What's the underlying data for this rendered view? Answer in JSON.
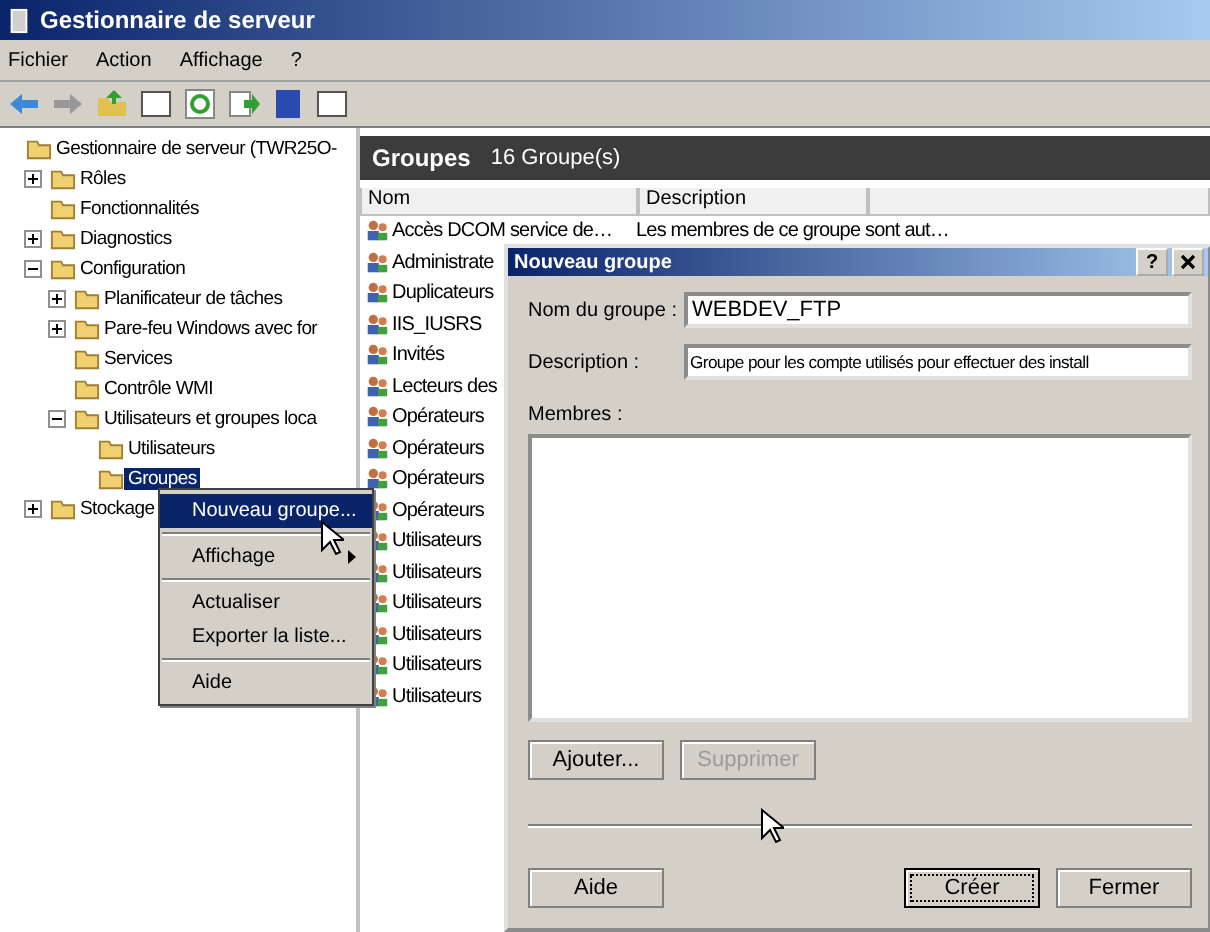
{
  "window": {
    "title": "Gestionnaire de serveur"
  },
  "menu": [
    "Fichier",
    "Action",
    "Affichage",
    "?"
  ],
  "tree": [
    {
      "label": "Gestionnaire de serveur (TWR25O-",
      "selected": false,
      "children": [
        {
          "label": "Rôles",
          "expanded": false,
          "selected": false
        },
        {
          "label": "Fonctionnalités",
          "selected": false
        },
        {
          "label": "Diagnostics",
          "expanded": false,
          "selected": false
        },
        {
          "label": "Configuration",
          "expanded": true,
          "selected": false,
          "children": [
            {
              "label": "Planificateur de tâches",
              "expanded": false,
              "selected": false
            },
            {
              "label": "Pare-feu Windows avec for",
              "expanded": false,
              "selected": false
            },
            {
              "label": "Services",
              "selected": false
            },
            {
              "label": "Contrôle WMI",
              "selected": false
            },
            {
              "label": "Utilisateurs et groupes loca",
              "expanded": true,
              "selected": false,
              "children": [
                {
                  "label": "Utilisateurs",
                  "selected": false
                },
                {
                  "label": "Groupes",
                  "selected": true
                }
              ]
            }
          ]
        },
        {
          "label": "Stockage",
          "expanded": false,
          "selected": false
        }
      ]
    }
  ],
  "pane": {
    "title": "Groupes",
    "count": "16 Groupe(s)",
    "columns": [
      "Nom",
      "Description"
    ],
    "rows": [
      {
        "name": "Accès DCOM service de…",
        "description": "Les membres de ce groupe sont aut…"
      },
      {
        "name": "Administrate"
      },
      {
        "name": "Duplicateurs"
      },
      {
        "name": "IIS_IUSRS"
      },
      {
        "name": "Invités"
      },
      {
        "name": "Lecteurs des"
      },
      {
        "name": "Opérateurs"
      },
      {
        "name": "Opérateurs"
      },
      {
        "name": "Opérateurs"
      },
      {
        "name": "Opérateurs"
      },
      {
        "name": "Utilisateurs"
      },
      {
        "name": "Utilisateurs"
      },
      {
        "name": "Utilisateurs"
      },
      {
        "name": "Utilisateurs"
      },
      {
        "name": "Utilisateurs"
      },
      {
        "name": "Utilisateurs"
      }
    ]
  },
  "context_menu": [
    {
      "kind": "item",
      "label": "Nouveau groupe...",
      "selected": true
    },
    {
      "kind": "separator"
    },
    {
      "kind": "submenu",
      "label": "Affichage",
      "selected": false
    },
    {
      "kind": "separator"
    },
    {
      "kind": "item",
      "label": "Actualiser",
      "selected": false
    },
    {
      "kind": "item",
      "label": "Exporter la liste...",
      "selected": false
    },
    {
      "kind": "separator"
    },
    {
      "kind": "item",
      "label": "Aide",
      "selected": false
    }
  ],
  "dialog": {
    "title": "Nouveau groupe",
    "help": "?",
    "fields": [
      {
        "label": "Nom du groupe :",
        "value": "WEBDEV_FTP"
      },
      {
        "label": "Description :",
        "value": "Groupe pour les compte utilisés pour effectuer des install"
      }
    ],
    "members_label": "Membres :",
    "member_buttons": [
      {
        "label": "Ajouter...",
        "disabled": false
      },
      {
        "label": "Supprimer",
        "disabled": true
      }
    ],
    "buttons": [
      {
        "label": "Aide",
        "default": false
      },
      {
        "label": "Créer",
        "default": true
      },
      {
        "label": "Fermer",
        "default": false
      }
    ]
  }
}
